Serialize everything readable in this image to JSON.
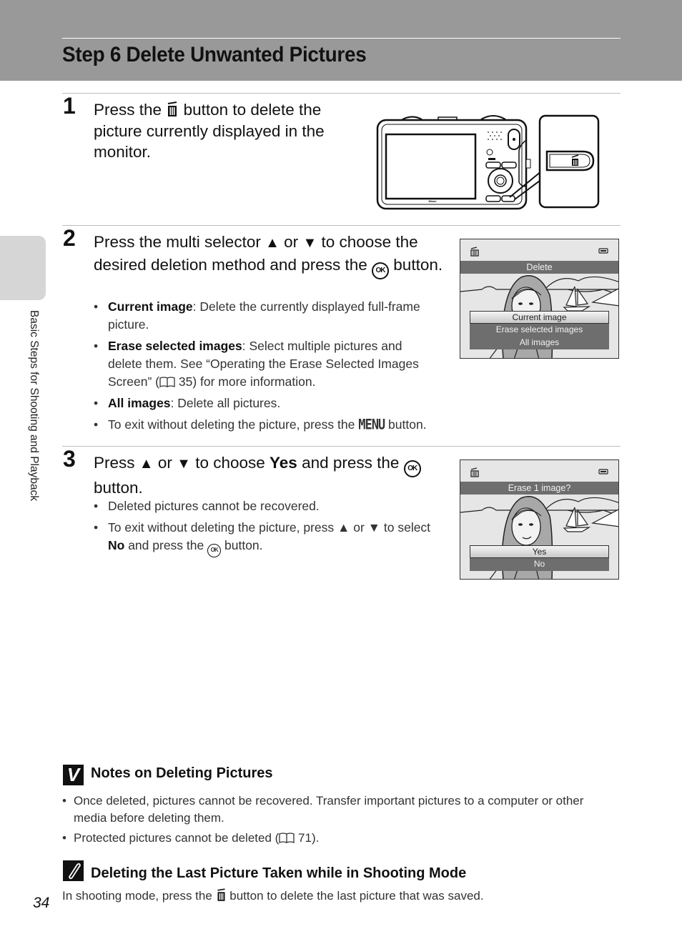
{
  "header": {
    "title": "Step 6 Delete Unwanted Pictures"
  },
  "side_tab": {
    "label": "Basic Steps for Shooting and Playback"
  },
  "steps": [
    {
      "number": "1",
      "text_before_icon": "Press the",
      "icon": "trash-icon",
      "text_after_icon": "button to delete the picture currently displayed in the monitor."
    },
    {
      "number": "2",
      "text_part1": "Press the multi selector",
      "up_symbol": "▲",
      "text_or": "or",
      "down_symbol": "▼",
      "text_part2": "to choose the desired deletion method and press the",
      "ok_label": "OK",
      "text_part3": "button.",
      "bullets": [
        {
          "bold": "Current image",
          "text": ": Delete the currently displayed full-frame picture."
        },
        {
          "bold": "Erase selected images",
          "text_before_ref": ": Select multiple pictures and delete them. See “Operating the Erase Selected Images Screen” (",
          "ref_page": "35",
          "text_after_ref": ") for more information."
        },
        {
          "bold": "All images",
          "text": ": Delete all pictures."
        },
        {
          "text_before": "To exit without deleting the picture, press the",
          "menu_label": "MENU",
          "text_after": "button."
        }
      ],
      "screen": {
        "title": "Delete",
        "menu_items": [
          "Current image",
          "Erase selected images",
          "All images"
        ],
        "selected_index": 0
      }
    },
    {
      "number": "3",
      "text_part1": "Press",
      "up_symbol": "▲",
      "text_or": "or",
      "down_symbol": "▼",
      "text_part2": "to choose",
      "bold_word": "Yes",
      "text_part3": "and press the",
      "ok_label": "OK",
      "text_part4": "button.",
      "bullets": [
        {
          "text": "Deleted pictures cannot be recovered."
        },
        {
          "text_before": "To exit without deleting the picture, press",
          "up_symbol": "▲",
          "text_or": "or",
          "down_symbol": "▼",
          "text_to": "to select",
          "bold": "No",
          "text_after": "and press the",
          "ok_label": "OK",
          "text_end": "button."
        }
      ],
      "screen": {
        "title": "Erase 1 image?",
        "menu_items": [
          "Yes",
          "No"
        ],
        "selected_index": 0
      }
    }
  ],
  "notes": {
    "heading": "Notes on Deleting Pictures",
    "icon_glyph": "V",
    "items": [
      {
        "text": "Once deleted, pictures cannot be recovered. Transfer important pictures to a computer or other media before deleting them."
      },
      {
        "text_before": "Protected pictures cannot be deleted (",
        "ref_page": "71",
        "text_after": ")."
      }
    ]
  },
  "tip": {
    "heading": "Deleting the Last Picture Taken while in Shooting Mode",
    "text_before": "In shooting mode, press the",
    "text_after": "button to delete the last picture that was saved."
  },
  "page_number": "34",
  "camera": {
    "brand_label": "Nikon"
  }
}
